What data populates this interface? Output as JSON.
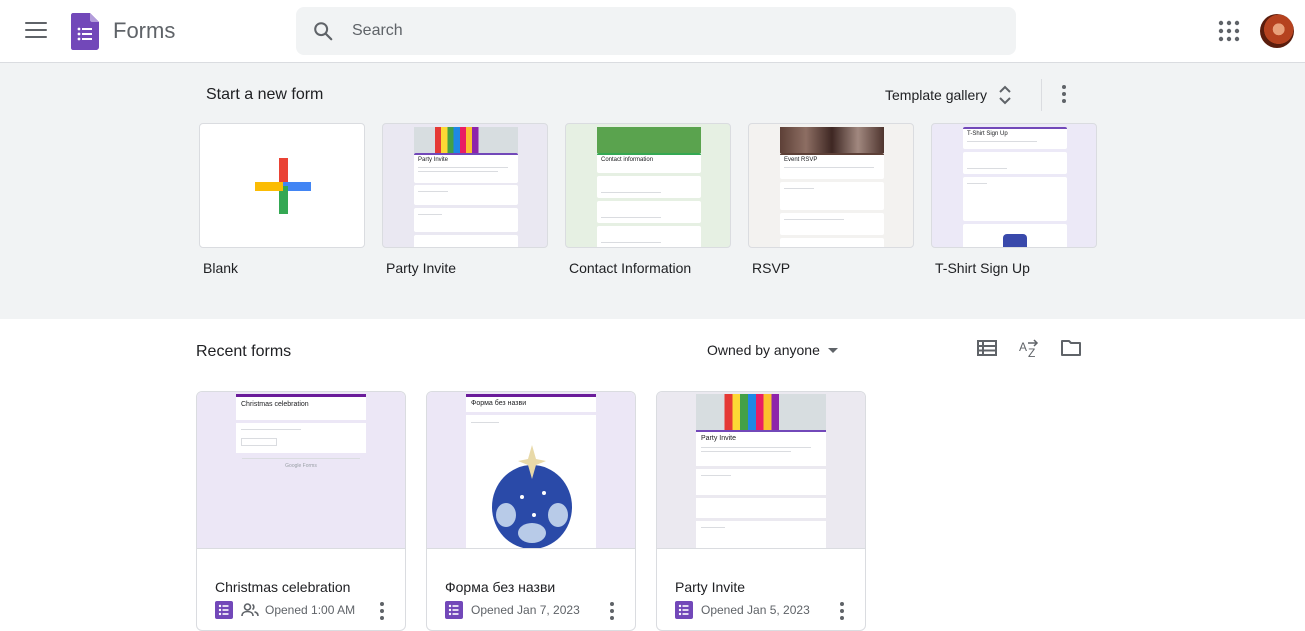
{
  "header": {
    "app_title": "Forms",
    "search_placeholder": "Search",
    "menu_icon": "hamburger-menu-icon",
    "apps_icon": "google-apps-grid-icon",
    "colors": {
      "brand": "#7248b9",
      "background": "#ffffff",
      "search_bg": "#f1f3f4"
    }
  },
  "templates": {
    "title": "Start a new form",
    "gallery_label": "Template gallery",
    "items": [
      {
        "label": "Blank"
      },
      {
        "label": "Party Invite",
        "preview_title": "Party Invite"
      },
      {
        "label": "Contact Information",
        "preview_title": "Contact information"
      },
      {
        "label": "RSVP",
        "preview_title": "Event RSVP"
      },
      {
        "label": "T-Shirt Sign Up",
        "preview_title": "T-Shirt Sign Up"
      }
    ]
  },
  "recent": {
    "title": "Recent forms",
    "owner_filter": "Owned by anyone",
    "docs": [
      {
        "title": "Christmas celebration",
        "preview_title": "Christmas celebration",
        "opened": "Opened 1:00 AM",
        "shared": true
      },
      {
        "title": "Форма без назви",
        "preview_title": "Форма без назви",
        "opened": "Opened Jan 7, 2023",
        "shared": false
      },
      {
        "title": "Party Invite",
        "preview_title": "Party Invite",
        "opened": "Opened Jan 5, 2023",
        "shared": false
      }
    ]
  }
}
